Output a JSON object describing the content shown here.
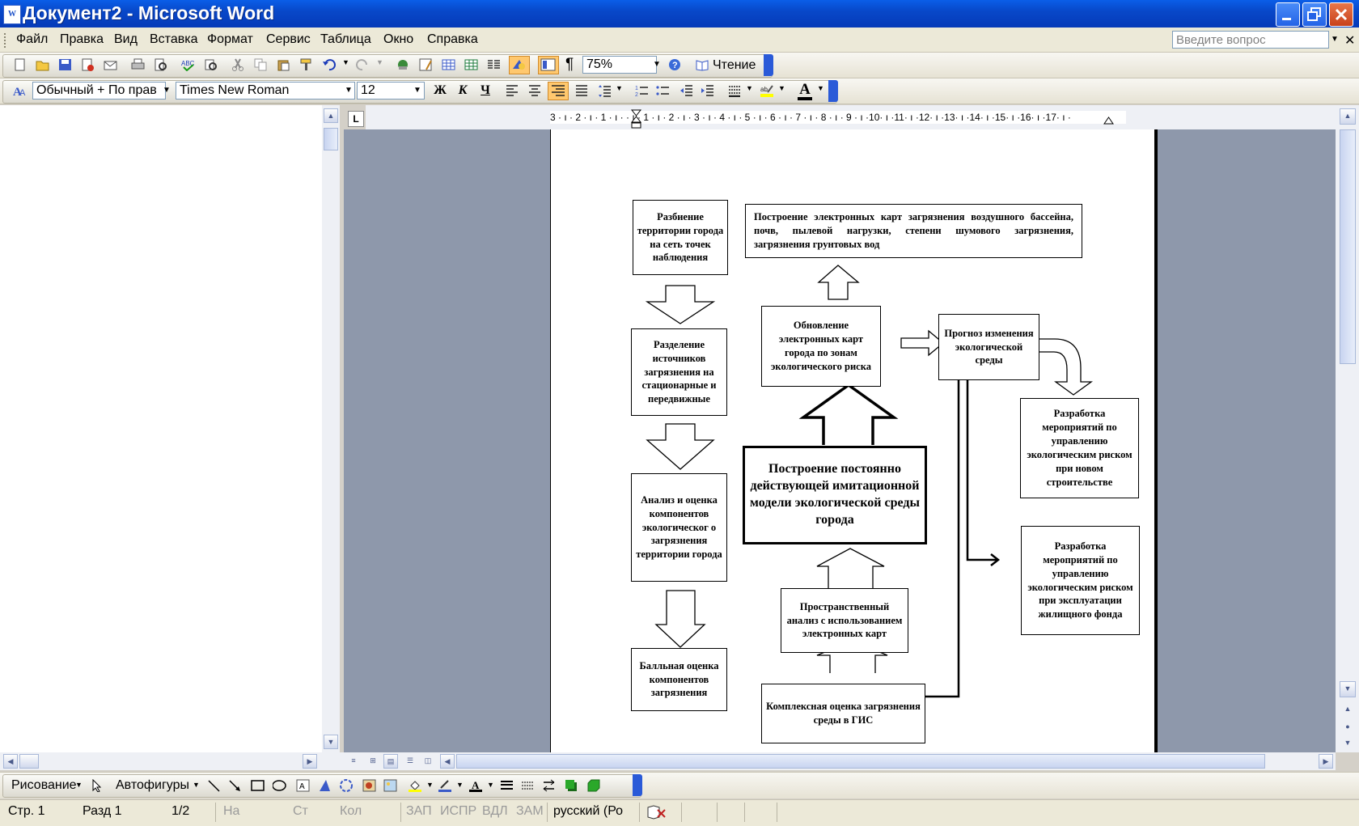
{
  "window": {
    "title": "Документ2 - Microsoft Word",
    "app_icon": "W"
  },
  "menu": {
    "items": [
      "Файл",
      "Правка",
      "Вид",
      "Вставка",
      "Формат",
      "Сервис",
      "Таблица",
      "Окно",
      "Справка"
    ],
    "ask_placeholder": "Введите вопрос"
  },
  "standard_toolbar": {
    "zoom": "75%",
    "reading_label": "Чтение",
    "pilcrow": "¶"
  },
  "formatting_toolbar": {
    "style": "Обычный + По прав",
    "font": "Times New Roman",
    "size": "12",
    "bold": "Ж",
    "italic": "К",
    "underline": "Ч",
    "font_color_letter": "A"
  },
  "ruler": {
    "tab_marker": "L",
    "text": "3 · ı · 2 · ı · 1 · ı ·  · ı · 1 · ı · 2 · ı · 3 · ı · 4 · ı · 5 · ı · 6 · ı · 7 · ı · 8 · ı · 9 · ı ·10· ı ·11· ı ·12· ı ·13· ı ·14· ı ·15· ı ·16· ı ·17· ı ·"
  },
  "diagram": {
    "boxes": {
      "b1": "Разбиение территории города на сеть точек наблюдения",
      "b2": "Разделение источников загрязнения на стационарные и передвижные",
      "b3": "Анализ и оценка компонентов экологическог о загрязнения территории города",
      "b4": "Балльная оценка компонентов загрязнения",
      "top": "Построение электронных карт загрязнения воздушного бассейна, почв, пылевой нагрузки, степени шумового загрязнения, загрязнения грунтовых вод",
      "update": "Обновление электронных карт города по зонам экологического риска",
      "forecast": "Прогноз изменения экологической среды",
      "model": "Построение постоянно действующей имитационной модели экологической среды города",
      "spatial": "Пространственный анализ с использованием электронных карт",
      "complex": "Комплексная оценка загрязнения среды в ГИС",
      "new_build": "Разработка мероприятий по управлению экологическим риском при новом строительстве",
      "exploit": "Разработка мероприятий по управлению экологическим риском при эксплуатации жилищного фонда"
    }
  },
  "drawing_toolbar": {
    "drawing_label": "Рисование",
    "autoshapes_label": "Автофигуры"
  },
  "status": {
    "page": "Стр. 1",
    "section": "Разд 1",
    "pages": "1/2",
    "at": "На",
    "line": "Ст",
    "col": "Кол",
    "rec": "ЗАП",
    "trk": "ИСПР",
    "ext": "ВДЛ",
    "ovr": "ЗАМ",
    "language": "русский (Ро"
  }
}
